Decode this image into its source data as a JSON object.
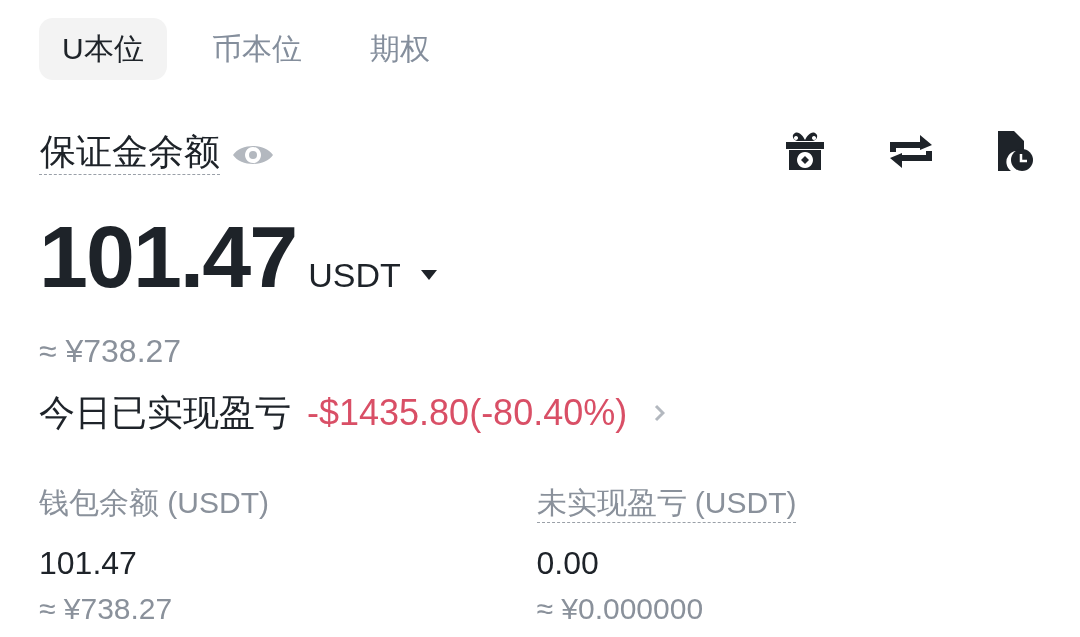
{
  "tabs": [
    {
      "label": "U本位",
      "selected": true
    },
    {
      "label": "币本位",
      "selected": false
    },
    {
      "label": "期权",
      "selected": false
    }
  ],
  "margin_balance": {
    "label": "保证金余额",
    "tooltip": true,
    "amount": "101.47",
    "currency": "USDT",
    "approx": "≈ ¥738.27"
  },
  "today_pnl": {
    "label": "今日已实现盈亏",
    "value": "-$1435.80(-80.40%)"
  },
  "stats": [
    {
      "label": "钱包余额 (USDT)",
      "tooltip": false,
      "value": "101.47",
      "approx": "≈ ¥738.27"
    },
    {
      "label": "未实现盈亏 (USDT)",
      "tooltip": true,
      "value": "0.00",
      "approx": "≈ ¥0.000000"
    }
  ]
}
